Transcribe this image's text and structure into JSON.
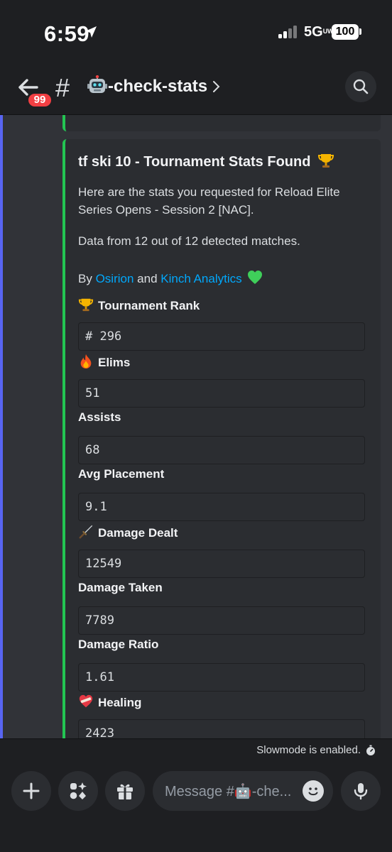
{
  "status_bar": {
    "time": "6:59",
    "network": "5G",
    "network_sub": "UW",
    "battery": "100"
  },
  "header": {
    "unread_badge": "99",
    "hash": "#",
    "channel_name": "-check-stats"
  },
  "embed": {
    "title": "tf ski 10 - Tournament Stats Found",
    "description": "Here are the stats you requested for Reload Elite Series Opens - Session 2 [NAC].",
    "data_line": "Data from 12 out of 12 detected matches.",
    "by_prefix": "By",
    "by_link1": "Osirion",
    "by_and": "and",
    "by_link2": "Kinch Analytics",
    "fields": [
      {
        "name": "Tournament Rank",
        "value": "# 296",
        "icon": "trophy-icon"
      },
      {
        "name": "Elims",
        "value": "51",
        "icon": "fire-icon"
      },
      {
        "name": "Assists",
        "value": "68",
        "icon": ""
      },
      {
        "name": "Avg Placement",
        "value": "9.1",
        "icon": ""
      },
      {
        "name": "Damage Dealt",
        "value": "12549",
        "icon": "sword-icon"
      },
      {
        "name": "Damage Taken",
        "value": "7789",
        "icon": ""
      },
      {
        "name": "Damage Ratio",
        "value": "1.61",
        "icon": ""
      },
      {
        "name": "Healing",
        "value": "2423",
        "icon": "bandaged-heart-icon"
      }
    ]
  },
  "slowmode_text": "Slowmode is enabled.",
  "composer": {
    "placeholder": "Message #🤖-che..."
  },
  "colors": {
    "accent_green": "#23c552",
    "link": "#00a8fc",
    "badge_red": "#f23f43",
    "blurple": "#5865f2"
  }
}
